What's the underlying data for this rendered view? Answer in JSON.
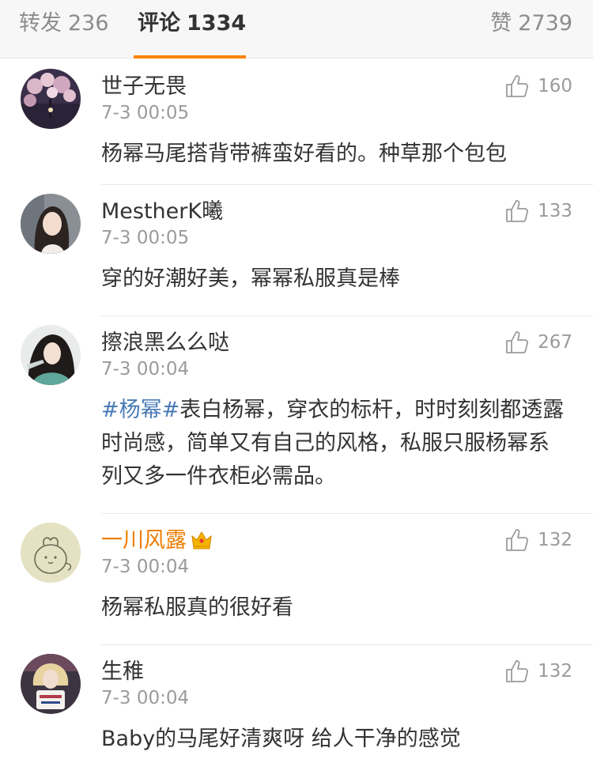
{
  "tabs": {
    "repost_label": "转发",
    "repost_count": "236",
    "comment_label": "评论",
    "comment_count": "1334",
    "like_label": "赞",
    "like_count": "2739",
    "active": "comment",
    "accent_color": "#ff8200"
  },
  "comments": [
    {
      "user": "世子无畏",
      "time": "7-3 00:05",
      "likes": "160",
      "text": "杨幂马尾搭背带裤蛮好看的。种草那个包包",
      "avatar": "cherry-blossom-avatar"
    },
    {
      "user": "MestherK曦",
      "time": "7-3 00:05",
      "likes": "133",
      "text": "穿的好潮好美，幂幂私服真是棒",
      "avatar": "girl-portrait-avatar"
    },
    {
      "user": "擦浪黑么么哒",
      "time": "7-3 00:04",
      "likes": "267",
      "topic": "#杨幂#",
      "text": "表白杨幂，穿衣的标杆，时时刻刻都透露时尚感，简单又有自己的风格，私服只服杨幂系列又多一件衣柜必需品。",
      "avatar": "costume-portrait-avatar"
    },
    {
      "user": "一川风露",
      "time": "7-3 00:04",
      "likes": "132",
      "text": "杨幂私服真的很好看",
      "avatar": "cartoon-animal-avatar",
      "name_color": "#ef7d00",
      "badge": "crown-icon"
    },
    {
      "user": "生稚",
      "time": "7-3 00:04",
      "likes": "132",
      "text": "Baby的马尾好清爽呀 给人干净的感觉",
      "avatar": "harley-portrait-avatar"
    }
  ]
}
